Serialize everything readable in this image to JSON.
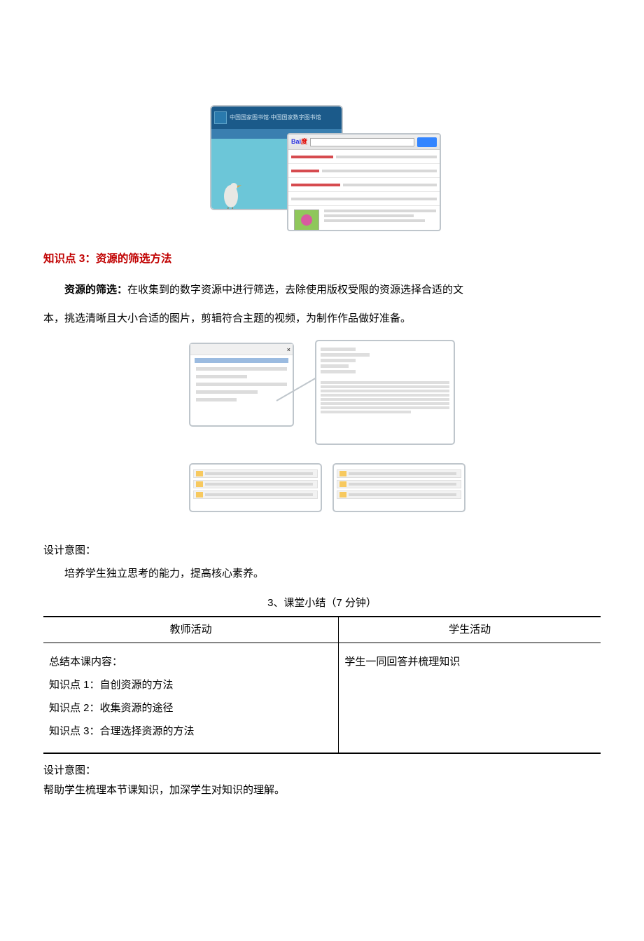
{
  "figure1": {
    "back_header_text": "中国国家图书馆·中国国家数字图书馆",
    "baidu_label_blue": "Bai",
    "baidu_label_red": "度"
  },
  "heading3": "知识点 3：资源的筛选方法",
  "para_bold": "资源的筛选：",
  "para_text1": "在收集到的数字资源中进行筛选，去除使用版权受限的资源选择合适的文",
  "para_text2": "本，挑选清晰且大小合适的图片，剪辑符合主题的视频，为制作作品做好准备。",
  "design_label1": "设计意图：",
  "design_text1": "培养学生独立思考的能力，提高核心素养。",
  "section3_title": "3、课堂小结（7 分钟）",
  "table": {
    "th_teacher": "教师活动",
    "th_student": "学生活动",
    "teacher_cell": {
      "line1": "总结本课内容：",
      "kp1": "知识点 1：自创资源的方法",
      "kp2": "知识点 2：收集资源的途径",
      "kp3": "知识点 3：合理选择资源的方法"
    },
    "student_cell": "学生一同回答并梳理知识"
  },
  "design_label2": "设计意图：",
  "design_text2": "帮助学生梳理本节课知识，加深学生对知识的理解。"
}
